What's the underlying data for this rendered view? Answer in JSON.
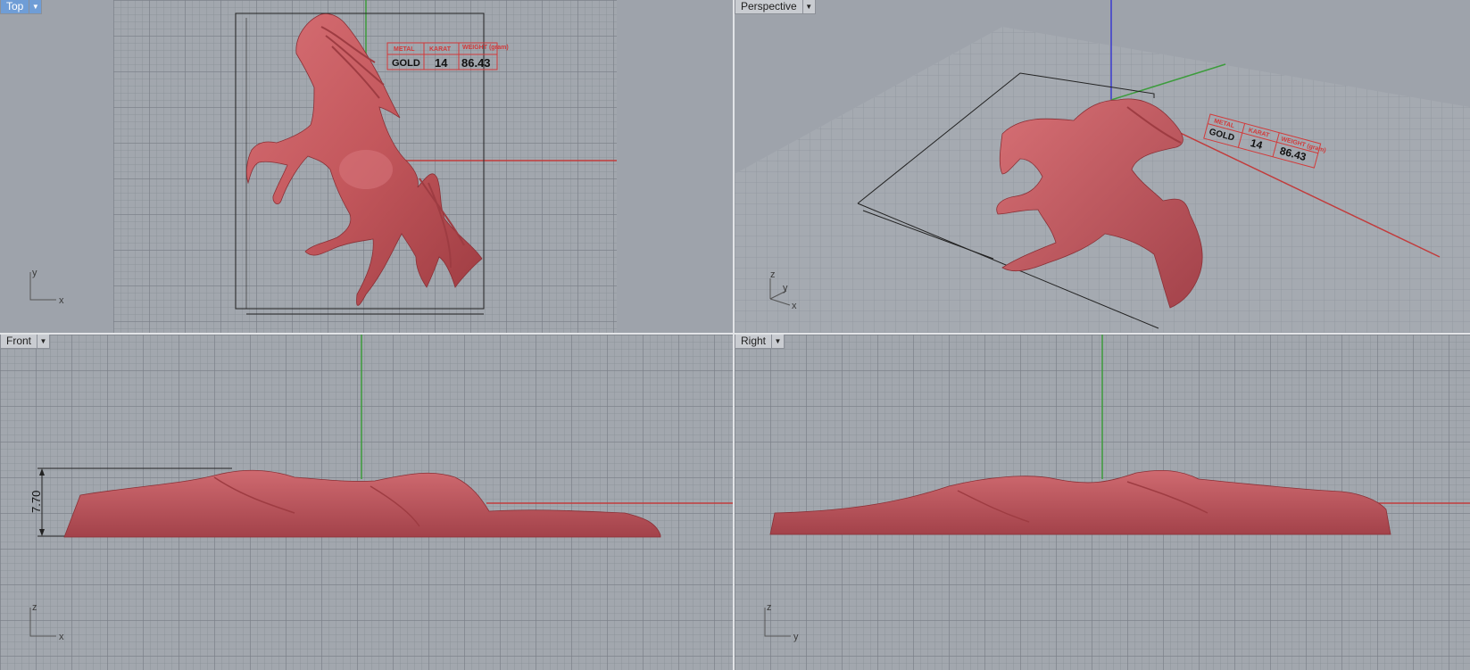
{
  "viewports": {
    "top": {
      "label": "Top",
      "active": true
    },
    "perspective": {
      "label": "Perspective",
      "active": false
    },
    "front": {
      "label": "Front",
      "active": false
    },
    "right": {
      "label": "Right",
      "active": false
    }
  },
  "axes": {
    "top": [
      "y",
      "x"
    ],
    "perspective": [
      "z",
      "y",
      "x"
    ],
    "front": [
      "z",
      "x"
    ],
    "right": [
      "z",
      "y"
    ]
  },
  "info_table": {
    "headers": [
      "METAL",
      "KARAT",
      "WEIGHT (gram)"
    ],
    "values": [
      "GOLD",
      "14",
      "86.43"
    ]
  },
  "dimensions": {
    "front_height": "7.70"
  },
  "colors": {
    "model": "#c95a5e",
    "x_axis": "#c23b3b",
    "y_axis": "#3c9c3c",
    "z_axis": "#3a3acf",
    "grid_bg": "#a2a7ae",
    "active_label": "#6f9dd6"
  },
  "menu_icon": "chevron-down-icon"
}
